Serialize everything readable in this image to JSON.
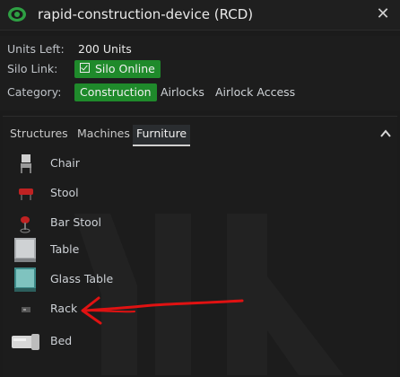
{
  "window": {
    "title": "rapid-construction-device (RCD)",
    "close_glyph": "✕"
  },
  "info": {
    "units_left_label": "Units Left:",
    "units_left_value": "200 Units",
    "silo_link_label": "Silo Link:",
    "silo_status": "Silo Online",
    "category_label": "Category:",
    "categories": [
      "Construction",
      "Airlocks",
      "Airlock Access"
    ]
  },
  "tabs": [
    "Structures",
    "Machines",
    "Furniture"
  ],
  "items": [
    {
      "name": "Chair",
      "icon": "chair-icon"
    },
    {
      "name": "Stool",
      "icon": "stool-icon"
    },
    {
      "name": "Bar Stool",
      "icon": "bar-stool-icon"
    },
    {
      "name": "Table",
      "icon": "table-icon"
    },
    {
      "name": "Glass Table",
      "icon": "glass-table-icon"
    },
    {
      "name": "Rack",
      "icon": "rack-icon"
    },
    {
      "name": "Bed",
      "icon": "bed-icon"
    }
  ],
  "colors": {
    "accent_green": "#1f8a2b",
    "annotation_red": "#e01212"
  }
}
